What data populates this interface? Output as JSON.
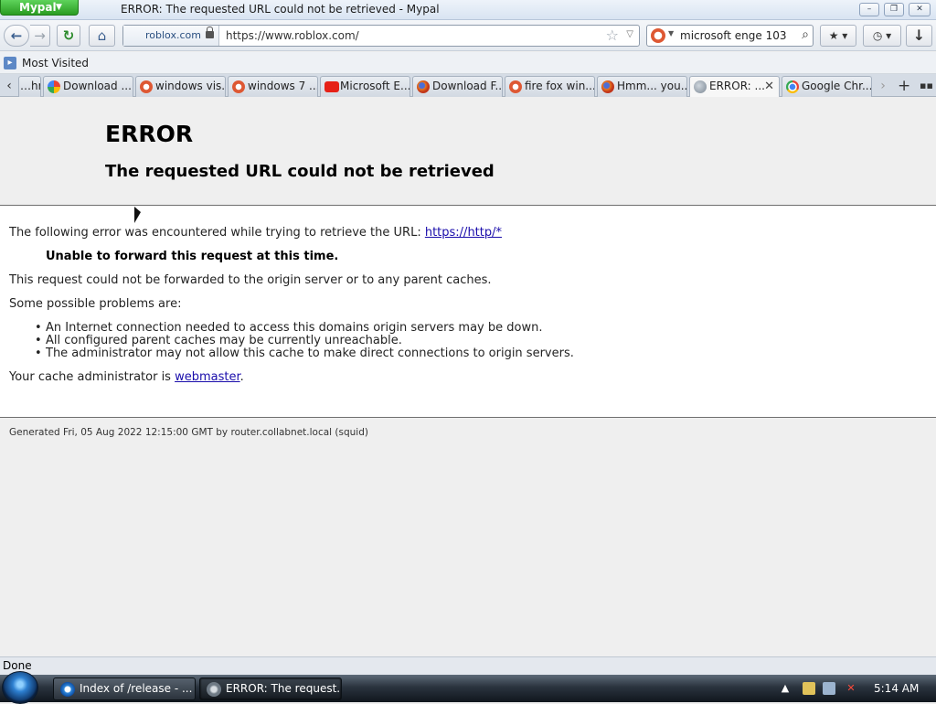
{
  "window": {
    "app_button": "Mypal",
    "title": "ERROR: The requested URL could not be retrieved - Mypal",
    "minimize": "–",
    "restore": "❐",
    "close": "✕"
  },
  "nav": {
    "back": "←",
    "forward": "→",
    "reload": "↻",
    "home": "⌂",
    "identity_label": "roblox.com",
    "url": "https://www.roblox.com/",
    "star": "☆",
    "dropdown": "▽",
    "search_value": "microsoft enge 103",
    "search_go": "⌕",
    "bookmarks_menu": "★ ▾",
    "history_menu": "◷ ▾",
    "downloads": "↓"
  },
  "bookmarks_bar": {
    "items": [
      {
        "label": "Most Visited",
        "icon": "most-visited-icon"
      }
    ]
  },
  "tabs": [
    {
      "label": "…hr...",
      "icon": "none"
    },
    {
      "label": "Download ...",
      "icon": "google-icon"
    },
    {
      "label": "windows vis...",
      "icon": "duckduckgo-icon"
    },
    {
      "label": "windows 7 ...",
      "icon": "duckduckgo-icon"
    },
    {
      "label": "Microsoft E...",
      "icon": "youtube-icon"
    },
    {
      "label": "Download F...",
      "icon": "firefox-icon"
    },
    {
      "label": "fire fox win...",
      "icon": "duckduckgo-icon"
    },
    {
      "label": "Hmm... you...",
      "icon": "firefox-icon"
    },
    {
      "label": "ERROR: ...",
      "icon": "globe-icon",
      "active": true,
      "close": "✕"
    },
    {
      "label": "Google Chr...",
      "icon": "chrome-icon"
    }
  ],
  "tab_controls": {
    "scroll_left": "‹",
    "scroll_right": "›",
    "new_tab": "+",
    "list_all": "▪▪"
  },
  "page": {
    "heading": "ERROR",
    "subheading": "The requested URL could not be retrieved",
    "intro": "The following error was encountered while trying to retrieve the URL: ",
    "intro_link": "https://http/*",
    "error_reason": "Unable to forward this request at this time.",
    "detail": "This request could not be forwarded to the origin server or to any parent caches.",
    "problems_intro": "Some possible problems are:",
    "problems": [
      "An Internet connection needed to access this domains origin servers may be down.",
      "All configured parent caches may be currently unreachable.",
      "The administrator may not allow this cache to make direct connections to origin servers."
    ],
    "admin_prefix": "Your cache administrator is ",
    "admin_link": "webmaster",
    "admin_suffix": ".",
    "generated": "Generated Fri, 05 Aug 2022 12:15:00 GMT by router.collabnet.local (squid)"
  },
  "status": {
    "text": "Done"
  },
  "taskbar": {
    "tasks": [
      {
        "label": "Index of /release - ...",
        "icon": "internet-explorer-icon"
      },
      {
        "label": "ERROR: The request...",
        "icon": "mypal-icon",
        "active": true
      }
    ],
    "tray": {
      "show_hidden": "▲",
      "clock": "5:14 AM"
    }
  },
  "colors": {
    "link": "#1a0dab",
    "page_bg": "#efefef",
    "content_bg": "#ffffff",
    "app_button": "#2a9c22"
  }
}
